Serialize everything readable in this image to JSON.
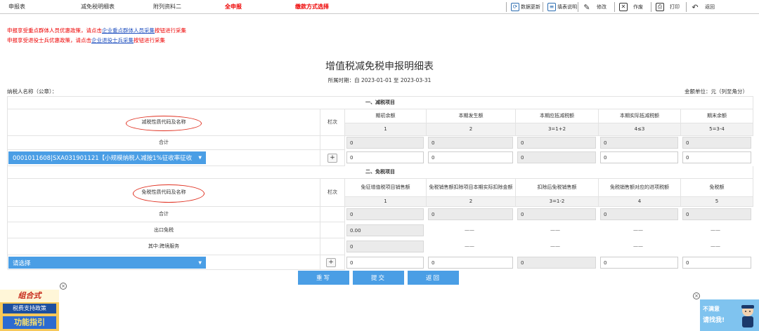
{
  "tabs": [
    {
      "label": "申报表",
      "active": false
    },
    {
      "label": "减免税明细表",
      "active": false
    },
    {
      "label": "附列资料二",
      "active": false
    },
    {
      "label": "全申报",
      "active": true
    },
    {
      "label": "缴款方式选择",
      "active": true
    }
  ],
  "toolbar": {
    "data_update": "数据更新",
    "fill_guide": "填表说明",
    "edit": "修改",
    "void": "作废",
    "print": "打印",
    "back": "返回"
  },
  "notices": [
    {
      "pre": "申报享受重点群体人员优惠政策，请点击",
      "link": "企业重点群体人员采集",
      "post": "按钮进行采集"
    },
    {
      "pre": "申报享受退役士兵优惠政策，请点击",
      "link": "企业退役士兵采集",
      "post": "按钮进行采集"
    }
  ],
  "form": {
    "title": "增值税减免税申报明细表",
    "period": "所属时期：自 2023-01-01 至 2023-03-31",
    "taxpayer": "纳税人名称（公章）：",
    "amount_unit": "金额单位：元（列至角分）"
  },
  "section1": {
    "title": "一、减税项目",
    "code_header": "减税性质代码及名称",
    "row_no": "栏次",
    "columns": [
      "期初余额",
      "本期发生额",
      "本期应抵减税额",
      "本期实际抵减税额",
      "期末余额"
    ],
    "col_nums": [
      "1",
      "2",
      "3=1+2",
      "4≤3",
      "5=3-4"
    ],
    "total_label": "合计",
    "total_values": [
      "0",
      "0",
      "0",
      "0",
      "0"
    ],
    "item_select": "0001011608|SXA031901121【小规模纳税人减按1%征收率征收",
    "add_symbol": "+",
    "item_values": [
      "0",
      "0",
      "0",
      "0",
      "0"
    ]
  },
  "section2": {
    "title": "二、免税项目",
    "code_header": "免税性质代码及名称",
    "row_no": "栏次",
    "columns": [
      "免征增值税项目销售额",
      "免税销售额扣除项目本期实际扣除金额",
      "扣除后免税销售额",
      "免税销售额对应的进项税额",
      "免税额"
    ],
    "col_nums": [
      "1",
      "2",
      "3=1-2",
      "4",
      "5"
    ],
    "total_label": "合计",
    "total_values": [
      "0",
      "0",
      "0",
      "0",
      "0"
    ],
    "export_label": "出口免税",
    "export_value": "0.00",
    "cross_label": "其中:跨境服务",
    "cross_value": "0",
    "dash": "——",
    "item_select": "请选择",
    "add_symbol": "+",
    "item_values": [
      "0",
      "0",
      "0",
      "0",
      "0"
    ]
  },
  "buttons": {
    "rewrite": "重写",
    "submit": "提交",
    "back": "返回"
  },
  "promo_left": {
    "line1": "组合式",
    "line2": "税费支持政策",
    "line3": "功能指引"
  },
  "promo_right": {
    "line1": "不满意",
    "line2": "请找我!"
  },
  "close_symbol": "×",
  "colors": {
    "accent": "#4a9ee5",
    "alert": "#e00000",
    "link": "#1f4fbf",
    "annotation": "#e03020"
  }
}
